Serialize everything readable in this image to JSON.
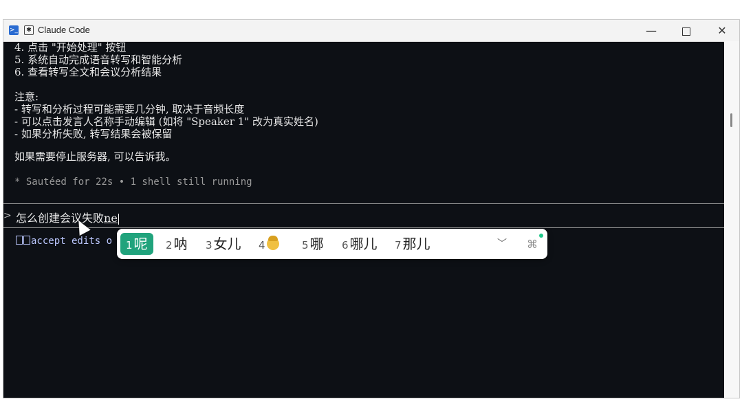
{
  "window": {
    "title": "Claude Code",
    "icons": [
      "powershell-icon",
      "claude-icon"
    ]
  },
  "terminal": {
    "steps": [
      "4. 点击 \"开始处理\" 按钮",
      "5. 系统自动完成语音转写和智能分析",
      "6. 查看转写全文和会议分析结果"
    ],
    "notes_heading": "注意:",
    "notes": [
      "- 转写和分析过程可能需要几分钟, 取决于音频长度",
      "- 可以点击发言人名称手动编辑 (如将 \"Speaker 1\" 改为真实姓名)",
      "- 如果分析失败, 转写结果会被保留"
    ],
    "closing": "如果需要停止服务器, 可以告诉我。",
    "status": "* Sautéed for 22s • 1 shell still running"
  },
  "prompt": {
    "symbol": ">",
    "text": "怎么创建会议失败",
    "composition": "ne"
  },
  "hint": {
    "text": "accept edits o"
  },
  "ime": {
    "candidates": [
      {
        "num": "1",
        "text": "呢"
      },
      {
        "num": "2",
        "text": "呐"
      },
      {
        "num": "3",
        "text": "女儿"
      },
      {
        "num": "4",
        "text": ""
      },
      {
        "num": "5",
        "text": "哪"
      },
      {
        "num": "6",
        "text": "哪儿"
      },
      {
        "num": "7",
        "text": "那儿"
      }
    ],
    "selected_index": 0,
    "accent_color": "#20a37c"
  }
}
